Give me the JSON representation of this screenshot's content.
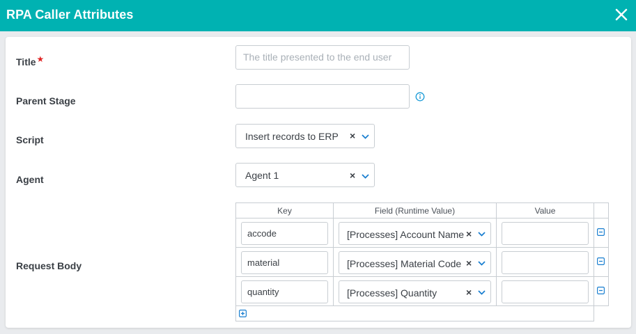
{
  "dialog": {
    "title": "RPA Caller Attributes",
    "accent_color": "#00b2b2",
    "close_icon": "close-icon"
  },
  "form": {
    "title": {
      "label": "Title",
      "required_marker": "★",
      "value": "",
      "placeholder": "The title presented to the end user"
    },
    "parent_stage": {
      "label": "Parent Stage",
      "value": "",
      "info_icon": "info-icon"
    },
    "script": {
      "label": "Script",
      "value": "Insert records to ERP",
      "clear": "×"
    },
    "agent": {
      "label": "Agent",
      "value": "Agent 1",
      "clear": "×"
    },
    "request_body": {
      "label": "Request Body",
      "columns": [
        "Key",
        "Field (Runtime Value)",
        "Value"
      ],
      "rows": [
        {
          "key": "accode",
          "field": "[Processes] Account Name",
          "value": ""
        },
        {
          "key": "material",
          "field": "[Processes] Material Code",
          "value": ""
        },
        {
          "key": "quantity",
          "field": "[Processes] Quantity",
          "value": ""
        }
      ],
      "clear": "×",
      "remove_icon": "minus-square-icon",
      "add_icon": "plus-square-icon"
    }
  }
}
